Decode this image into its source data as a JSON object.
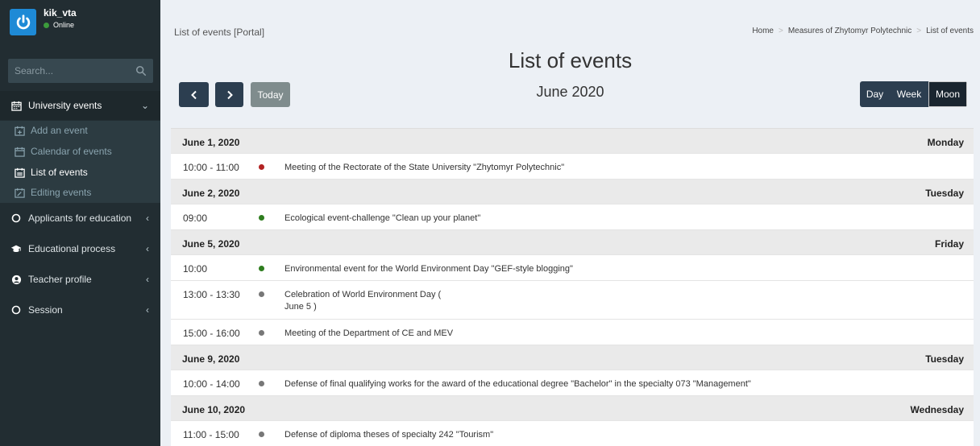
{
  "user": {
    "name": "kik_vta",
    "status": "Online"
  },
  "search": {
    "placeholder": "Search..."
  },
  "sidebar": {
    "items": [
      {
        "label": "University events",
        "icon": "calendar-icon",
        "expanded": true
      },
      {
        "label": "Applicants for education",
        "icon": "circle-icon"
      },
      {
        "label": "Educational process",
        "icon": "graduation-cap-icon"
      },
      {
        "label": "Teacher profile",
        "icon": "user-circle-icon"
      },
      {
        "label": "Session",
        "icon": "circle-icon"
      }
    ],
    "subitems": [
      {
        "label": "Add an event",
        "icon": "calendar-plus-icon"
      },
      {
        "label": "Calendar of events",
        "icon": "calendar-icon"
      },
      {
        "label": "List of events",
        "icon": "calendar-list-icon",
        "active": true
      },
      {
        "label": "Editing events",
        "icon": "calendar-edit-icon"
      }
    ]
  },
  "header": {
    "title": "List of events [Portal]",
    "breadcrumb": [
      "Home",
      "Measures of Zhytomyr Polytechnic",
      "List of events"
    ]
  },
  "calendar": {
    "title": "List of events",
    "subtitle": "June 2020",
    "today_label": "Today",
    "views": [
      "Day",
      "Week",
      "Moon"
    ],
    "active_view": "Moon"
  },
  "colors": {
    "sidebar_bg": "#222d32",
    "accent": "#2c3e50",
    "dot_red": "#b22222",
    "dot_green": "#2e7d1f",
    "dot_gray": "#777777"
  },
  "events": [
    {
      "date": "June 1, 2020",
      "weekday": "Monday",
      "items": [
        {
          "time": "10:00 - 11:00",
          "color": "#b22222",
          "title": "Meeting of the Rectorate of the State University \"Zhytomyr Polytechnic\""
        }
      ]
    },
    {
      "date": "June 2, 2020",
      "weekday": "Tuesday",
      "items": [
        {
          "time": "09:00",
          "color": "#2e7d1f",
          "title": "Ecological event-challenge \"Clean up your planet\""
        }
      ]
    },
    {
      "date": "June 5, 2020",
      "weekday": "Friday",
      "items": [
        {
          "time": "10:00",
          "color": "#2e7d1f",
          "title": "Environmental event for the World Environment Day \"GEF-style blogging\""
        },
        {
          "time": "13:00 - 13:30",
          "color": "#777777",
          "title": "Celebration of World Environment Day (",
          "title2": "June 5 )"
        },
        {
          "time": "15:00 - 16:00",
          "color": "#777777",
          "title": "Meeting of the Department of CE and MEV"
        }
      ]
    },
    {
      "date": "June 9, 2020",
      "weekday": "Tuesday",
      "items": [
        {
          "time": "10:00 - 14:00",
          "color": "#777777",
          "title": "Defense of final qualifying works for the award of the educational degree \"Bachelor\" in the specialty 073 \"Management\""
        }
      ]
    },
    {
      "date": "June 10, 2020",
      "weekday": "Wednesday",
      "items": [
        {
          "time": "11:00 - 15:00",
          "color": "#777777",
          "title": "Defense of diploma theses of specialty 242 \"Tourism\""
        }
      ]
    }
  ]
}
